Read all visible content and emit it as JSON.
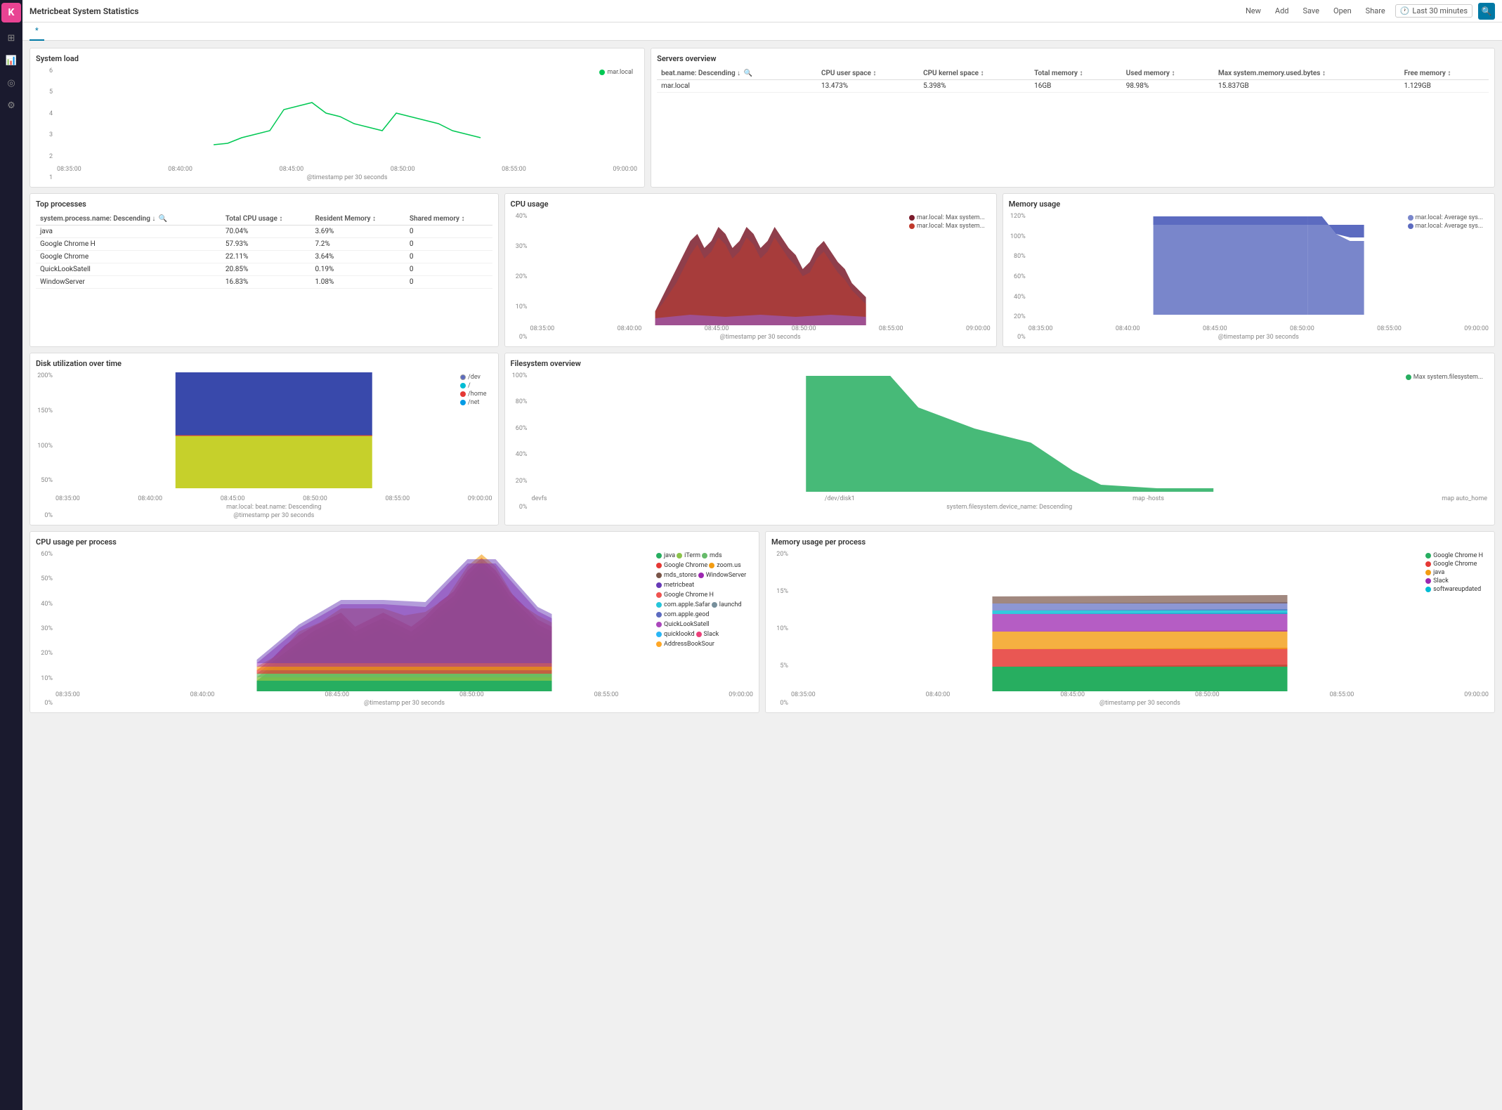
{
  "app": {
    "title": "Metricbeat System Statistics",
    "tab": "*"
  },
  "topbar": {
    "new_label": "New",
    "add_label": "Add",
    "save_label": "Save",
    "open_label": "Open",
    "share_label": "Share",
    "time_filter": "Last 30 minutes",
    "search_icon": "🔍"
  },
  "sidebar": {
    "logo": "K",
    "icons": [
      "⊞",
      "📊",
      "◎",
      "⚙"
    ]
  },
  "panels": {
    "system_load": {
      "title": "System load",
      "legend": "mar.local",
      "x_axis": "@timestamp per 30 seconds",
      "x_labels": [
        "08:35:00",
        "08:40:00",
        "08:45:00",
        "08:50:00",
        "08:55:00",
        "09:00:00"
      ],
      "y_labels": [
        "6",
        "5",
        "4",
        "3",
        "2",
        "1"
      ],
      "accent_color": "#00c853"
    },
    "servers_overview": {
      "title": "Servers overview",
      "columns": [
        "beat.name: Descending ↓",
        "CPU user space ↕",
        "CPU kernel space ↕",
        "Total memory ↕",
        "Used memory ↕",
        "Max system.memory.used.bytes ↕",
        "Free memory ↕"
      ],
      "rows": [
        [
          "mar.local",
          "13.473%",
          "5.398%",
          "16GB",
          "98.98%",
          "15.837GB",
          "1.129GB"
        ]
      ]
    },
    "top_processes": {
      "title": "Top processes",
      "columns": [
        "system.process.name: Descending ↓",
        "Total CPU usage ↕",
        "Resident Memory ↕",
        "Shared memory ↕"
      ],
      "rows": [
        [
          "java",
          "70.04%",
          "3.69%",
          "0"
        ],
        [
          "Google Chrome H",
          "57.93%",
          "7.2%",
          "0"
        ],
        [
          "Google Chrome",
          "22.11%",
          "3.64%",
          "0"
        ],
        [
          "QuickLookSatell",
          "20.85%",
          "0.19%",
          "0"
        ],
        [
          "WindowServer",
          "16.83%",
          "1.08%",
          "0"
        ]
      ]
    },
    "cpu_usage": {
      "title": "CPU usage",
      "x_axis": "@timestamp per 30 seconds",
      "x_labels": [
        "08:35:00",
        "08:40:00",
        "08:45:00",
        "08:50:00",
        "08:55:00",
        "09:00:00"
      ],
      "y_labels": [
        "40%",
        "30%",
        "20%",
        "10%",
        "0%"
      ],
      "legend": [
        {
          "label": "mar.local: Max system...",
          "color": "#7B1C2C"
        },
        {
          "label": "mar.local: Max system...",
          "color": "#c0392b"
        }
      ]
    },
    "memory_usage": {
      "title": "Memory usage",
      "x_axis": "@timestamp per 30 seconds",
      "x_labels": [
        "08:35:00",
        "08:40:00",
        "08:45:00",
        "08:50:00",
        "08:55:00",
        "09:00:00"
      ],
      "y_labels": [
        "120%",
        "100%",
        "80%",
        "60%",
        "40%",
        "20%",
        "0%"
      ],
      "legend": [
        {
          "label": "mar.local: Average sys...",
          "color": "#7986CB"
        },
        {
          "label": "mar.local: Average sys...",
          "color": "#5c6bc0"
        }
      ]
    },
    "disk_utilization": {
      "title": "Disk utilization over time",
      "x_axis": "@timestamp per 30 seconds",
      "x_labels": [
        "08:35:00",
        "08:40:00",
        "08:45:00",
        "08:50:00",
        "08:55:00",
        "09:00:00"
      ],
      "y_labels": [
        "200%",
        "150%",
        "100%",
        "50%",
        "0%"
      ],
      "legend": [
        {
          "label": "/dev",
          "color": "#5c6bc0"
        },
        {
          "label": "/",
          "color": "#00bcd4"
        },
        {
          "label": "/home",
          "color": "#e53935"
        },
        {
          "label": "/net",
          "color": "#039be5"
        }
      ],
      "x_sub_label": "mar.local: beat.name: Descending"
    },
    "filesystem_overview": {
      "title": "Filesystem overview",
      "x_axis": "system.filesystem.device_name: Descending",
      "x_labels": [
        "devfs",
        "",
        "",
        "",
        "",
        "/dev/disk1",
        "",
        "",
        "",
        "",
        "map -hosts",
        "",
        "",
        "",
        "",
        "map auto_home"
      ],
      "y_labels": [
        "100%",
        "80%",
        "60%",
        "40%",
        "20%",
        "0%"
      ],
      "legend": [
        {
          "label": "Max system.filesystem...",
          "color": "#27ae60"
        }
      ]
    },
    "cpu_usage_per_process": {
      "title": "CPU usage per process",
      "x_axis": "@timestamp per 30 seconds",
      "x_labels": [
        "08:35:00",
        "08:40:00",
        "08:45:00",
        "08:50:00",
        "08:55:00",
        "09:00:00"
      ],
      "y_labels": [
        "60%",
        "50%",
        "40%",
        "30%",
        "20%",
        "10%",
        "0%"
      ],
      "legend": [
        {
          "label": "java",
          "color": "#27ae60"
        },
        {
          "label": "iTerm",
          "color": "#8bc34a"
        },
        {
          "label": "mds",
          "color": "#66bb6a"
        },
        {
          "label": "Google Chrome",
          "color": "#e53935"
        },
        {
          "label": "zoom.us",
          "color": "#f39c12"
        },
        {
          "label": "mds_stores",
          "color": "#795548"
        },
        {
          "label": "WindowServer",
          "color": "#9c27b0"
        },
        {
          "label": "metricbeat",
          "color": "#673ab7"
        },
        {
          "label": "Google Chrome H",
          "color": "#ef5350"
        },
        {
          "label": "com.apple.Safar",
          "color": "#26c6da"
        },
        {
          "label": "launchd",
          "color": "#78909c"
        },
        {
          "label": "com.apple.geod",
          "color": "#5c6bc0"
        },
        {
          "label": "QuickLookSatell",
          "color": "#ab47bc"
        },
        {
          "label": "quicklookd",
          "color": "#29b6f6"
        },
        {
          "label": "Slack",
          "color": "#ec407a"
        },
        {
          "label": "AddressBookSour",
          "color": "#ffa726"
        }
      ]
    },
    "memory_usage_per_process": {
      "title": "Memory usage per process",
      "x_axis": "@timestamp per 30 seconds",
      "x_labels": [
        "08:35:00",
        "08:40:00",
        "08:45:00",
        "08:50:00",
        "08:55:00",
        "09:00:00"
      ],
      "y_labels": [
        "20%",
        "15%",
        "10%",
        "5%",
        "0%"
      ],
      "legend": [
        {
          "label": "Google Chrome H",
          "color": "#27ae60"
        },
        {
          "label": "Google Chrome",
          "color": "#e53935"
        },
        {
          "label": "java",
          "color": "#f39c12"
        },
        {
          "label": "Slack",
          "color": "#9c27b0"
        },
        {
          "label": "softwareupdated",
          "color": "#00bcd4"
        }
      ]
    }
  }
}
